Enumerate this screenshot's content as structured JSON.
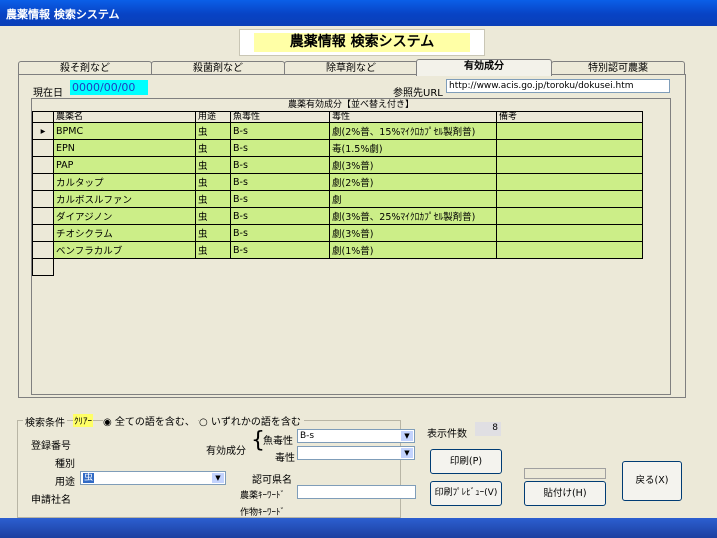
{
  "window": {
    "title": "農薬情報  検索システム"
  },
  "banner": {
    "title": "農薬情報  検索システム"
  },
  "tabs": [
    {
      "label": "殺そ剤など"
    },
    {
      "label": "殺菌剤など"
    },
    {
      "label": "除草剤など"
    },
    {
      "label": "有効成分"
    },
    {
      "label": "特別認可農薬"
    }
  ],
  "header": {
    "current_label": "現在日",
    "current_date": "0000/00/00",
    "ref_label": "参照先URL",
    "ref_url": "http://www.acis.go.jp/toroku/dokusei.htm"
  },
  "grid": {
    "title": "農薬有効成分【並べ替え付き】",
    "columns": [
      "農薬名",
      "用途",
      "魚毒性",
      "毒性",
      "備考"
    ],
    "rows": [
      [
        "BPMC",
        "虫",
        "B-s",
        "劇(2%普、15%ﾏｲｸﾛｶﾌﾟｾﾙ製剤普)",
        ""
      ],
      [
        "EPN",
        "虫",
        "B-s",
        "毒(1.5%劇)",
        ""
      ],
      [
        "PAP",
        "虫",
        "B-s",
        "劇(3%普)",
        ""
      ],
      [
        "カルタップ",
        "虫",
        "B-s",
        "劇(2%普)",
        ""
      ],
      [
        "カルボスルファン",
        "虫",
        "B-s",
        "劇",
        ""
      ],
      [
        "ダイアジノン",
        "虫",
        "B-s",
        "劇(3%普、25%ﾏｲｸﾛｶﾌﾟｾﾙ製剤普)",
        ""
      ],
      [
        "チオシクラム",
        "虫",
        "B-s",
        "劇(3%普)",
        ""
      ],
      [
        "ベンフラカルブ",
        "虫",
        "B-s",
        "劇(1%普)",
        ""
      ]
    ]
  },
  "search": {
    "group_label": "検索条件",
    "clear_label": "ｸﾘｱｰ",
    "option_all": "全ての語を含む、",
    "option_any": "いずれかの語を含む",
    "reg_no_label": "登録番号",
    "type_label": "種別",
    "use_label": "用途",
    "use_value": "虫",
    "applicant_label": "申請社名",
    "ingredient_label": "有効成分",
    "fish_tox_label": "魚毒性",
    "fish_tox_value": "B-s",
    "tox_label": "毒性",
    "tox_value": "",
    "pref_label": "認可県名",
    "pesticide_kw_label": "農薬ｷｰﾜｰﾄﾞ",
    "crop_kw_label": "作物ｷｰﾜｰﾄﾞ"
  },
  "count": {
    "label": "表示件数",
    "value": "8"
  },
  "buttons": {
    "print": "印刷(P)",
    "print_preview": "印刷ﾌﾟﾚﾋﾞｭｰ(V)",
    "paste": "貼付け(H)",
    "back": "戻る(X)"
  },
  "colors": {
    "titlebar": "#0A4FD6",
    "date_bg": "#00FFFF",
    "row_bg": "#CCEE88",
    "banner_bg": "#FFFFA6"
  }
}
